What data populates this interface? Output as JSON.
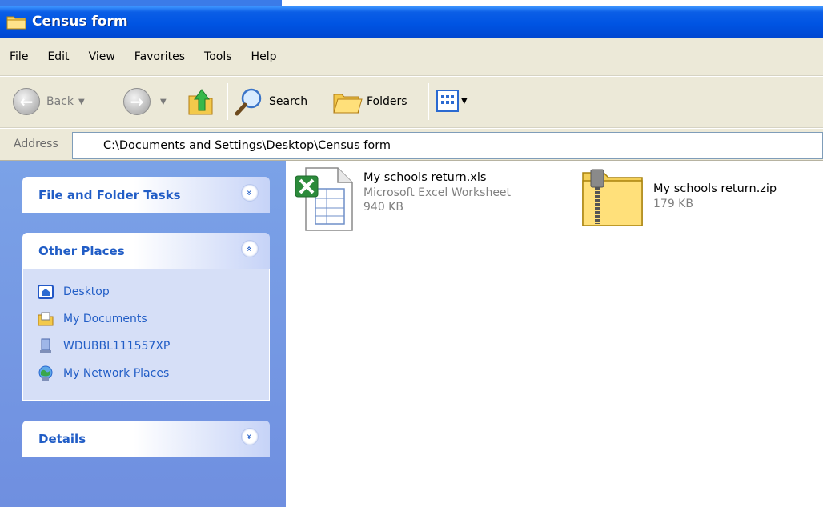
{
  "window": {
    "title": "Census form"
  },
  "menu": [
    "File",
    "Edit",
    "View",
    "Favorites",
    "Tools",
    "Help"
  ],
  "toolbar": {
    "back_label": "Back",
    "search_label": "Search",
    "folders_label": "Folders"
  },
  "address": {
    "label": "Address",
    "path": "C:\\Documents and Settings\\Desktop\\Census form"
  },
  "panels": {
    "file_tasks": {
      "title": "File and Folder Tasks",
      "collapse_glyph": "»"
    },
    "other_places": {
      "title": "Other Places",
      "collapse_glyph": "«",
      "items": [
        "Desktop",
        "My Documents",
        "WDUBBL111557XP",
        "My Network Places"
      ]
    },
    "details": {
      "title": "Details",
      "collapse_glyph": "»"
    }
  },
  "files": [
    {
      "name": "My schools return.xls",
      "type": "Microsoft Excel Worksheet",
      "size": "940 KB",
      "icon": "excel-file-icon"
    },
    {
      "name": "My schools return.zip",
      "size": "179 KB",
      "icon": "zip-folder-icon"
    }
  ],
  "colors": {
    "titlebar": "#0054e3",
    "taskpane": "#7ba2e7",
    "link": "#215dc6",
    "chrome": "#ece9d8"
  }
}
